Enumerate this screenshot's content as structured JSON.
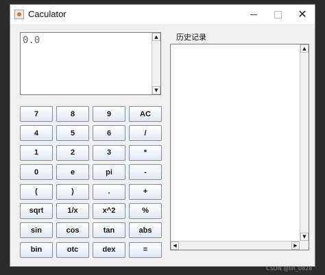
{
  "window": {
    "title": "Caculator",
    "controls": {
      "minimize": "minimize-icon",
      "maximize": "maximize-icon",
      "close_glyph": "✕"
    }
  },
  "display": {
    "value": "0.0",
    "scroll_up": "▲",
    "scroll_down": "▼"
  },
  "keypad": {
    "keys": [
      "7",
      "8",
      "9",
      "AC",
      "4",
      "5",
      "6",
      "/",
      "1",
      "2",
      "3",
      "*",
      "0",
      "e",
      "pi",
      "-",
      "(",
      ")",
      ".",
      "+",
      "sqrt",
      "1/x",
      "x^2",
      "%",
      "sin",
      "cos",
      "tan",
      "abs",
      "bin",
      "otc",
      "dex",
      "="
    ]
  },
  "history": {
    "label": "历史记录",
    "scroll_up": "▲",
    "scroll_down": "▼",
    "scroll_left": "◀",
    "scroll_right": "▶"
  },
  "watermark": "CSDN @lin_0828"
}
